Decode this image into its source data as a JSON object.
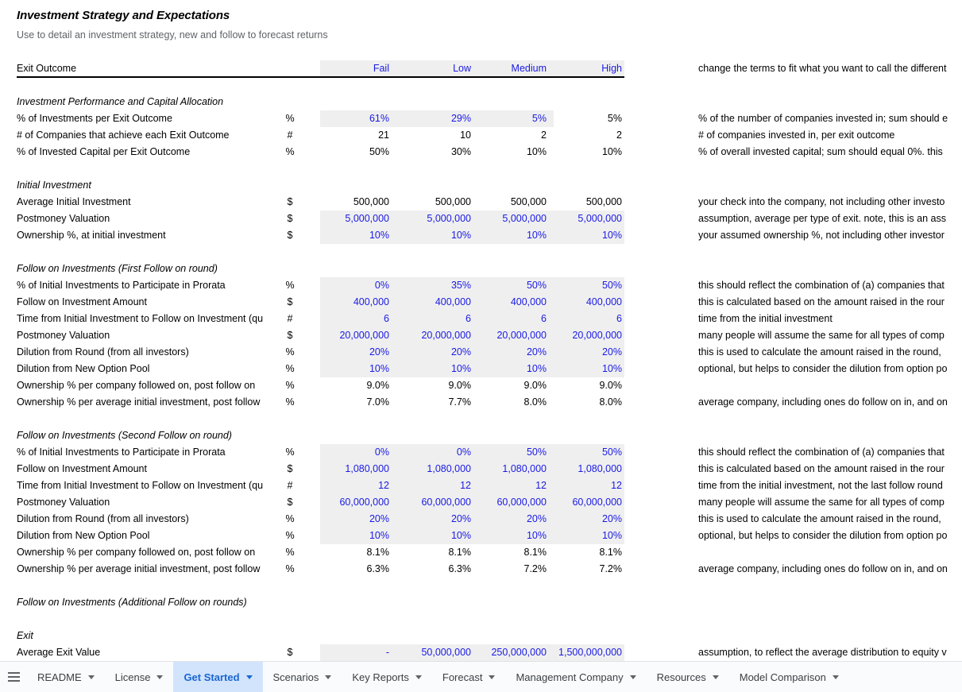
{
  "sheet": {
    "title": "Investment Strategy and Expectations",
    "subtitle": "Use to detail an investment strategy, new and follow to forecast returns",
    "header_row": {
      "label": "Exit Outcome",
      "unit": "",
      "columns": [
        "Fail",
        "Low",
        "Medium",
        "High"
      ],
      "note": "change the terms to fit what you want to call the different"
    },
    "rows": [
      {
        "label": "Investment Performance and Capital Allocation",
        "kind": "section",
        "unit": "",
        "values": [
          "",
          "",
          "",
          ""
        ],
        "note": ""
      },
      {
        "label": "% of Investments per Exit Outcome",
        "kind": "data",
        "unit": "%",
        "values": [
          "61%",
          "29%",
          "5%",
          "5%"
        ],
        "styles": [
          "input",
          "input",
          "input",
          "calc"
        ],
        "shade": "three",
        "note": "% of the number of companies invested in; sum should e"
      },
      {
        "label": "# of Companies that achieve each Exit Outcome",
        "kind": "data",
        "unit": "#",
        "values": [
          "21",
          "10",
          "2",
          "2"
        ],
        "styles": [
          "calc",
          "calc",
          "calc",
          "calc"
        ],
        "shade": "none",
        "note": "# of companies invested in, per exit outcome"
      },
      {
        "label": "% of Invested Capital per Exit Outcome",
        "kind": "data",
        "unit": "%",
        "values": [
          "50%",
          "30%",
          "10%",
          "10%"
        ],
        "styles": [
          "calc",
          "calc",
          "calc",
          "calc"
        ],
        "shade": "none",
        "note": "% of overall invested capital; sum should equal 0%. this"
      },
      {
        "label": "",
        "kind": "spacer",
        "unit": "",
        "values": [
          "",
          "",
          "",
          ""
        ],
        "note": ""
      },
      {
        "label": "Initial Investment",
        "kind": "section",
        "unit": "",
        "values": [
          "",
          "",
          "",
          ""
        ],
        "note": ""
      },
      {
        "label": "Average Initial Investment",
        "kind": "data",
        "unit": "$",
        "values": [
          "500,000",
          "500,000",
          "500,000",
          "500,000"
        ],
        "styles": [
          "calc",
          "calc",
          "calc",
          "calc"
        ],
        "shade": "none",
        "note": "your check into the company, not including other investo"
      },
      {
        "label": "Postmoney Valuation",
        "kind": "data",
        "unit": "$",
        "values": [
          "5,000,000",
          "5,000,000",
          "5,000,000",
          "5,000,000"
        ],
        "styles": [
          "input",
          "input",
          "input",
          "input"
        ],
        "shade": "four",
        "note": "assumption, average per type of exit. note, this is an ass"
      },
      {
        "label": "Ownership %, at initial investment",
        "kind": "data",
        "unit": "$",
        "values": [
          "10%",
          "10%",
          "10%",
          "10%"
        ],
        "styles": [
          "input",
          "input",
          "input",
          "input"
        ],
        "shade": "four",
        "note": "your assumed ownership %, not including other investor"
      },
      {
        "label": "",
        "kind": "spacer",
        "unit": "",
        "values": [
          "",
          "",
          "",
          ""
        ],
        "note": ""
      },
      {
        "label": "Follow on Investments (First Follow on round)",
        "kind": "section",
        "unit": "",
        "values": [
          "",
          "",
          "",
          ""
        ],
        "note": ""
      },
      {
        "label": "% of Initial Investments to Participate in Prorata",
        "kind": "data",
        "unit": "%",
        "values": [
          "0%",
          "35%",
          "50%",
          "50%"
        ],
        "styles": [
          "input",
          "input",
          "input",
          "input"
        ],
        "shade": "four",
        "note": "this should reflect the combination of (a) companies that"
      },
      {
        "label": "Follow on Investment Amount",
        "kind": "data",
        "unit": "$",
        "values": [
          "400,000",
          "400,000",
          "400,000",
          "400,000"
        ],
        "styles": [
          "input",
          "input",
          "input",
          "input"
        ],
        "shade": "four",
        "note": "this is calculated based on the amount raised in the rour"
      },
      {
        "label": "Time from Initial Investment to Follow on Investment (qu",
        "kind": "data",
        "unit": "#",
        "values": [
          "6",
          "6",
          "6",
          "6"
        ],
        "styles": [
          "input",
          "input",
          "input",
          "input"
        ],
        "shade": "four",
        "note": "time from the initial investment"
      },
      {
        "label": "Postmoney Valuation",
        "kind": "data",
        "unit": "$",
        "values": [
          "20,000,000",
          "20,000,000",
          "20,000,000",
          "20,000,000"
        ],
        "styles": [
          "input",
          "input",
          "input",
          "input"
        ],
        "shade": "four",
        "note": "many people will assume the same for all types of comp"
      },
      {
        "label": "Dilution from Round (from all investors)",
        "kind": "data",
        "unit": "%",
        "values": [
          "20%",
          "20%",
          "20%",
          "20%"
        ],
        "styles": [
          "input",
          "input",
          "input",
          "input"
        ],
        "shade": "four",
        "note": "this is used to calculate the amount raised in the round, "
      },
      {
        "label": "Dilution from New Option Pool",
        "kind": "data",
        "unit": "%",
        "values": [
          "10%",
          "10%",
          "10%",
          "10%"
        ],
        "styles": [
          "input",
          "input",
          "input",
          "input"
        ],
        "shade": "four",
        "note": "optional, but helps to consider the dilution from option po"
      },
      {
        "label": "Ownership % per company followed on, post follow on",
        "kind": "data",
        "unit": "%",
        "values": [
          "9.0%",
          "9.0%",
          "9.0%",
          "9.0%"
        ],
        "styles": [
          "calc",
          "calc",
          "calc",
          "calc"
        ],
        "shade": "none",
        "note": ""
      },
      {
        "label": "Ownership % per average initial investment, post follow",
        "kind": "data",
        "unit": "%",
        "values": [
          "7.0%",
          "7.7%",
          "8.0%",
          "8.0%"
        ],
        "styles": [
          "calc",
          "calc",
          "calc",
          "calc"
        ],
        "shade": "none",
        "note": "average company, including ones do follow on in, and on"
      },
      {
        "label": "",
        "kind": "spacer",
        "unit": "",
        "values": [
          "",
          "",
          "",
          ""
        ],
        "note": ""
      },
      {
        "label": "Follow on Investments (Second Follow on round)",
        "kind": "section",
        "unit": "",
        "values": [
          "",
          "",
          "",
          ""
        ],
        "note": ""
      },
      {
        "label": "% of Initial Investments to Participate in Prorata",
        "kind": "data",
        "unit": "%",
        "values": [
          "0%",
          "0%",
          "50%",
          "50%"
        ],
        "styles": [
          "input",
          "input",
          "input",
          "input"
        ],
        "shade": "four",
        "note": "this should reflect the combination of (a) companies that"
      },
      {
        "label": "Follow on Investment Amount",
        "kind": "data",
        "unit": "$",
        "values": [
          "1,080,000",
          "1,080,000",
          "1,080,000",
          "1,080,000"
        ],
        "styles": [
          "input",
          "input",
          "input",
          "input"
        ],
        "shade": "four",
        "note": "this is calculated based on the amount raised in the rour"
      },
      {
        "label": "Time from Initial Investment to Follow on Investment (qu",
        "kind": "data",
        "unit": "#",
        "values": [
          "12",
          "12",
          "12",
          "12"
        ],
        "styles": [
          "input",
          "input",
          "input",
          "input"
        ],
        "shade": "four",
        "note": "time from the initial investment, not the last follow round"
      },
      {
        "label": "Postmoney Valuation",
        "kind": "data",
        "unit": "$",
        "values": [
          "60,000,000",
          "60,000,000",
          "60,000,000",
          "60,000,000"
        ],
        "styles": [
          "input",
          "input",
          "input",
          "input"
        ],
        "shade": "four",
        "note": "many people will assume the same for all types of comp"
      },
      {
        "label": "Dilution from Round (from all investors)",
        "kind": "data",
        "unit": "%",
        "values": [
          "20%",
          "20%",
          "20%",
          "20%"
        ],
        "styles": [
          "input",
          "input",
          "input",
          "input"
        ],
        "shade": "four",
        "note": "this is used to calculate the amount raised in the round, "
      },
      {
        "label": "Dilution from New Option Pool",
        "kind": "data",
        "unit": "%",
        "values": [
          "10%",
          "10%",
          "10%",
          "10%"
        ],
        "styles": [
          "input",
          "input",
          "input",
          "input"
        ],
        "shade": "four",
        "note": "optional, but helps to consider the dilution from option po"
      },
      {
        "label": "Ownership % per company followed on, post follow on",
        "kind": "data",
        "unit": "%",
        "values": [
          "8.1%",
          "8.1%",
          "8.1%",
          "8.1%"
        ],
        "styles": [
          "calc",
          "calc",
          "calc",
          "calc"
        ],
        "shade": "none",
        "note": ""
      },
      {
        "label": "Ownership % per average initial investment, post follow",
        "kind": "data",
        "unit": "%",
        "values": [
          "6.3%",
          "6.3%",
          "7.2%",
          "7.2%"
        ],
        "styles": [
          "calc",
          "calc",
          "calc",
          "calc"
        ],
        "shade": "none",
        "note": "average company, including ones do follow on in, and on"
      },
      {
        "label": "",
        "kind": "spacer",
        "unit": "",
        "values": [
          "",
          "",
          "",
          ""
        ],
        "note": ""
      },
      {
        "label": "Follow on Investments (Additional Follow on rounds)",
        "kind": "section",
        "unit": "",
        "values": [
          "",
          "",
          "",
          ""
        ],
        "note": ""
      },
      {
        "label": "",
        "kind": "spacer",
        "unit": "",
        "values": [
          "",
          "",
          "",
          ""
        ],
        "note": ""
      },
      {
        "label": "Exit",
        "kind": "section",
        "unit": "",
        "values": [
          "",
          "",
          "",
          ""
        ],
        "note": ""
      },
      {
        "label": "Average Exit Value",
        "kind": "data",
        "unit": "$",
        "values": [
          "-",
          "50,000,000",
          "250,000,000",
          "1,500,000,000"
        ],
        "styles": [
          "input",
          "input",
          "input",
          "input"
        ],
        "shade": "four",
        "note": "assumption, to reflect the average distribution to equity v"
      }
    ]
  },
  "tabbar": {
    "menu_icon": "hamburger-icon",
    "tabs": [
      {
        "label": "README",
        "active": false
      },
      {
        "label": "License",
        "active": false
      },
      {
        "label": "Get Started",
        "active": true
      },
      {
        "label": "Scenarios",
        "active": false
      },
      {
        "label": "Key Reports",
        "active": false
      },
      {
        "label": "Forecast",
        "active": false
      },
      {
        "label": "Management Company",
        "active": false
      },
      {
        "label": "Resources",
        "active": false
      },
      {
        "label": "Model Comparison",
        "active": false
      }
    ]
  },
  "colors": {
    "input_text": "#1a1ae6",
    "calc_text": "#000000",
    "shade_bg": "#efefef",
    "active_tab_bg": "#d2e3fc",
    "active_tab_text": "#1967d2"
  }
}
